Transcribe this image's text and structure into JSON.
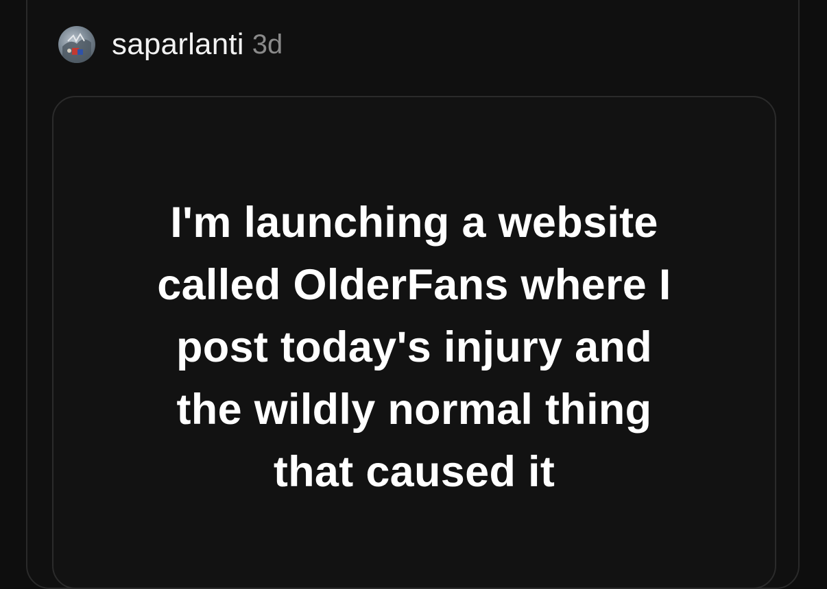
{
  "post": {
    "author": "saparlanti",
    "time_ago": "3d",
    "avatar_icon": "user-avatar-icon"
  },
  "quote": {
    "lines": [
      "I'm launching a website",
      "called OlderFans where I",
      "post today's injury and",
      "the wildly normal thing",
      "that caused it"
    ]
  },
  "colors": {
    "background": "#0e0e0e",
    "text_primary": "#ffffff",
    "text_secondary": "#8a8a8a",
    "border": "#2a2a2a"
  }
}
